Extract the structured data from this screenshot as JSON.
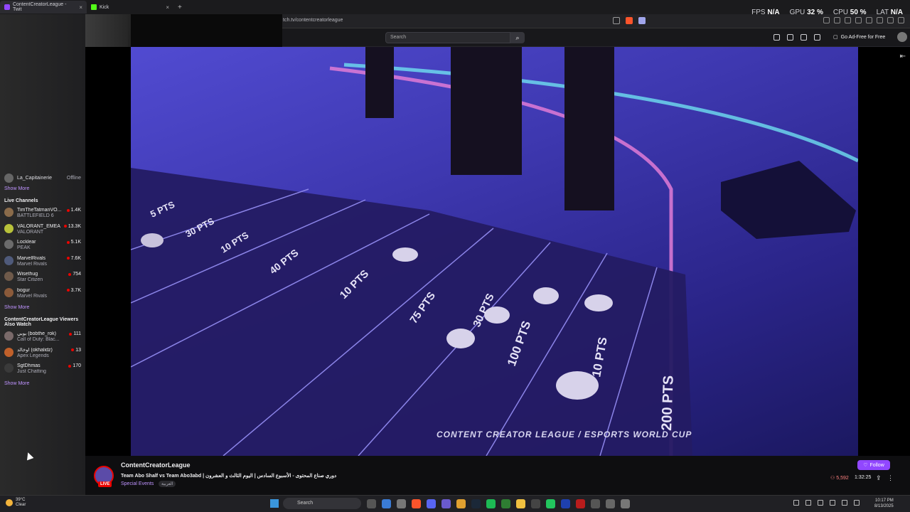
{
  "browser": {
    "tabs": [
      {
        "label": "ContentCreatorLeague - Twit",
        "active": true
      },
      {
        "label": "Kick",
        "active": false
      }
    ],
    "url": "tch.tv/contentcreatorleague"
  },
  "overlay_stats": {
    "fps_label": "FPS",
    "fps_value": "N/A",
    "gpu_label": "GPU",
    "gpu_value": "32 %",
    "cpu_label": "CPU",
    "cpu_value": "50 %",
    "lat_label": "LAT",
    "lat_value": "N/A"
  },
  "topnav": {
    "search_placeholder": "Search",
    "adfree_label": "Go Ad-Free for Free"
  },
  "sidebar": {
    "followed": [
      {
        "name": "La_Capitainerie",
        "status": "Offline"
      }
    ],
    "show_more_1": "Show More",
    "live_title": "Live Channels",
    "live_channels": [
      {
        "name": "TimTheTatmanVO...",
        "game": "BATTLEFIELD 6",
        "viewers": "1.4K"
      },
      {
        "name": "VALORANT_EMEA",
        "game": "VALORANT",
        "viewers": "13.3K"
      },
      {
        "name": "Locklear",
        "game": "PEAK",
        "viewers": "5.1K"
      },
      {
        "name": "MarvelRivals",
        "game": "Marvel Rivals",
        "viewers": "7.6K"
      },
      {
        "name": "Wisethug",
        "game": "Star Citizen",
        "viewers": "754"
      },
      {
        "name": "bogur",
        "game": "Marvel Rivals",
        "viewers": "3.7K"
      }
    ],
    "show_more_2": "Show More",
    "also_watch_title": "ContentCreatorLeague Viewers Also Watch",
    "also_watch": [
      {
        "name": "بوبي (bobthe_rok)",
        "game": "Call of Duty: Blac...",
        "viewers": "111"
      },
      {
        "name": "أوخالد (okhalidz)",
        "game": "Apex Legends",
        "viewers": "13"
      },
      {
        "name": "SgtDhmas",
        "game": "Just Chatting",
        "viewers": "170"
      }
    ],
    "show_more_3": "Show More"
  },
  "player": {
    "field_labels": [
      "5 PTS",
      "30 PTS",
      "10 PTS",
      "40 PTS",
      "10 PTS",
      "75 PTS",
      "30 PTS",
      "100 PTS",
      "10 PTS",
      "200 PTS"
    ],
    "logo_text": "CONTENT CREATOR LEAGUE / ESPORTS WORLD CUP"
  },
  "stream": {
    "channel": "ContentCreatorLeague",
    "live_badge": "LIVE",
    "title": "Team Abo Shalf vs Team Abo3abd | دوري صناع المحتوى - الأسبوع السادس | اليوم الثالث و العشرون",
    "category": "Special Events",
    "language": "العربية",
    "follow_label": "Follow",
    "viewers": "5,592",
    "uptime": "1:32:25"
  },
  "taskbar": {
    "temp": "39°C",
    "weather": "Clear",
    "search_label": "Search",
    "time": "10:17 PM",
    "date": "8/13/2025"
  },
  "colors": {
    "twitch_purple": "#9147ff",
    "live_red": "#eb0400",
    "link_purple": "#bf94ff"
  }
}
